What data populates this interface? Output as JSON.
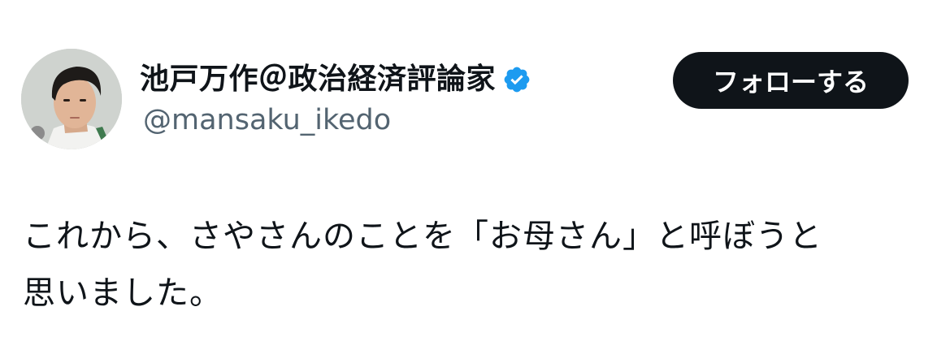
{
  "author": {
    "display_name": "池戸万作＠政治経済評論家",
    "handle": "@mansaku_ikedo",
    "verified": true,
    "avatar": "profile-photo"
  },
  "actions": {
    "follow_label": "フォローする"
  },
  "tweet": {
    "text": "これから、さやさんのことを「お母さん」と呼ぼうと\n思いました。"
  },
  "colors": {
    "verified_blue": "#1d9bf0",
    "follow_bg": "#0f1419",
    "handle_gray": "#536471"
  }
}
